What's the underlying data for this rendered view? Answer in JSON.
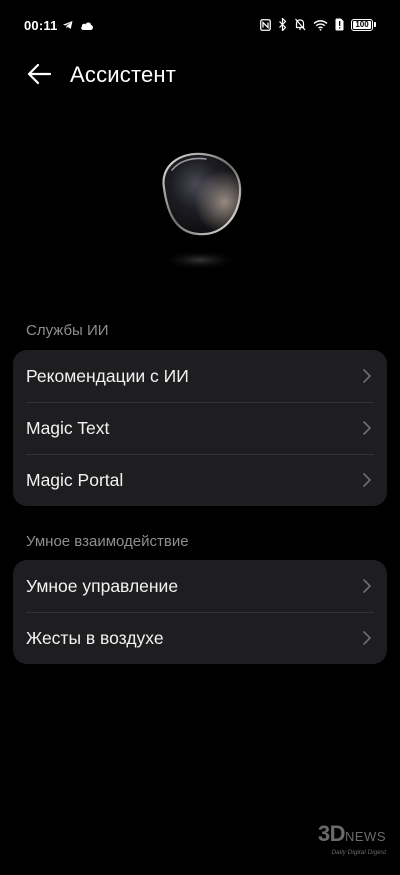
{
  "status_bar": {
    "time": "00:11",
    "left_icons": [
      "telegram-icon",
      "cloud-icon"
    ],
    "right_icons": [
      "nfc-icon",
      "bluetooth-icon",
      "mute-bell-icon",
      "wifi-icon",
      "sim-alert-icon"
    ],
    "battery": "100",
    "battery_level_percent": 100
  },
  "header": {
    "back_icon": "arrow-left-icon",
    "title": "Ассистент"
  },
  "hero": {
    "icon": "assistant-orb-icon"
  },
  "sections": [
    {
      "label": "Службы ИИ",
      "items": [
        {
          "label": "Рекомендации с ИИ"
        },
        {
          "label": "Magic Text"
        },
        {
          "label": "Magic Portal"
        }
      ]
    },
    {
      "label": "Умное взаимодействие",
      "items": [
        {
          "label": "Умное управление"
        },
        {
          "label": "Жесты в воздухе"
        }
      ]
    }
  ],
  "watermark": {
    "logo": "3D",
    "logo_suffix": "NEWS",
    "tagline": "Daily Digital Digest"
  },
  "colors": {
    "background": "#000000",
    "card": "#1e1e20",
    "section_label": "#8e8e93",
    "divider": "#333336"
  }
}
